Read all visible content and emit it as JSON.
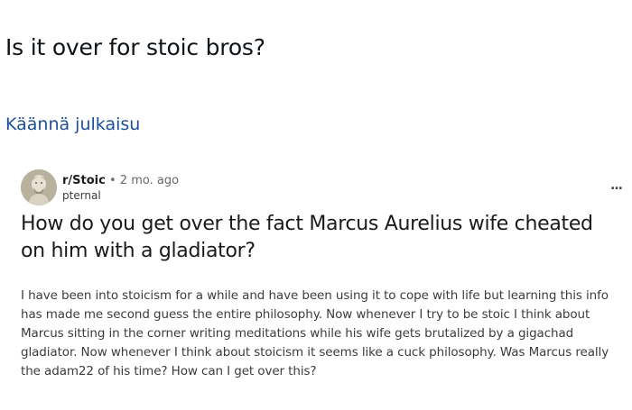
{
  "post": {
    "text": "Is it over for stoic bros?",
    "translate_label": "Käännä julkaisu"
  },
  "embedded_reddit": {
    "subreddit": "r/Stoic",
    "separator": "•",
    "time_ago": "2 mo. ago",
    "username": "pternal",
    "more_label": "...",
    "title": "How do you get over the fact Marcus Aurelius wife cheated on him with a gladiator?",
    "body": "I have been into stoicism for a while and have been using it to cope with life but learning this info has made me second guess the entire philosophy. Now whenever I try to be stoic I think about Marcus sitting in the corner writing meditations while his wife gets brutalized by a gigachad gladiator. Now whenever I think about stoicism it seems like a cuck philosophy. Was Marcus really the adam22 of his time? How can I get over this?",
    "avatar_icon": "bust-statue-avatar-icon"
  },
  "colors": {
    "link": "#1d4f9a",
    "text": "#0f1419",
    "body_text": "#3c3c3c"
  }
}
